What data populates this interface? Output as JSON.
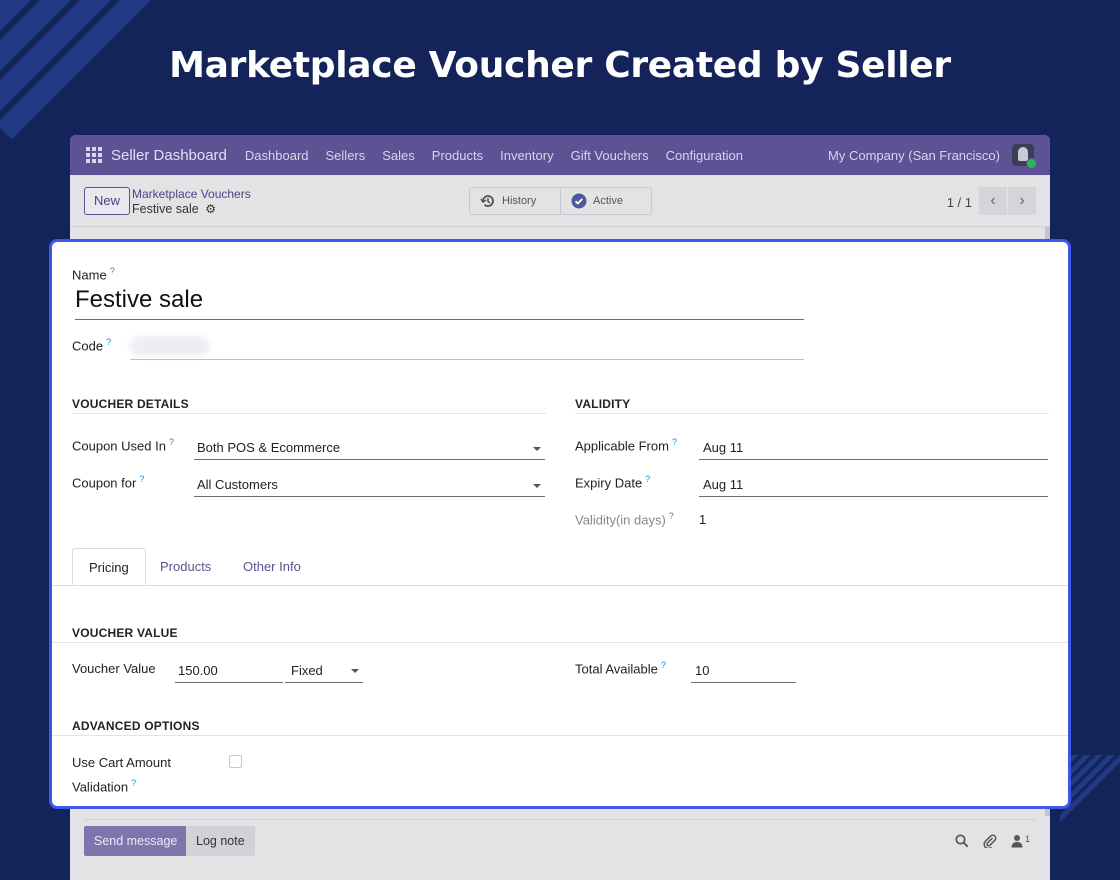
{
  "hero": {
    "title": "Marketplace Voucher Created by Seller"
  },
  "navbar": {
    "brand": "Seller Dashboard",
    "items": [
      "Dashboard",
      "Sellers",
      "Sales",
      "Products",
      "Inventory",
      "Gift Vouchers",
      "Configuration"
    ],
    "company": "My Company (San Francisco)"
  },
  "controlbar": {
    "new_label": "New",
    "breadcrumb_parent": "Marketplace Vouchers",
    "breadcrumb_current": "Festive sale",
    "history_label": "History",
    "active_label": "Active",
    "pager": "1 / 1"
  },
  "form": {
    "name_label": "Name",
    "name_value": "Festive sale",
    "code_label": "Code",
    "help_mark": "?",
    "voucher_details": {
      "title": "VOUCHER DETAILS",
      "coupon_used_in_label": "Coupon Used In",
      "coupon_used_in_value": "Both POS & Ecommerce",
      "coupon_for_label": "Coupon for",
      "coupon_for_value": "All Customers"
    },
    "validity": {
      "title": "VALIDITY",
      "applicable_from_label": "Applicable From",
      "applicable_from_value": "Aug 11",
      "expiry_date_label": "Expiry Date",
      "expiry_date_value": "Aug 11",
      "validity_days_label": "Validity(in days)",
      "validity_days_value": "1"
    },
    "tabs": [
      "Pricing",
      "Products",
      "Other Info"
    ],
    "active_tab": "Pricing",
    "voucher_value_section": {
      "title": "VOUCHER VALUE",
      "voucher_value_label": "Voucher Value",
      "voucher_value": "150.00",
      "voucher_type": "Fixed",
      "total_available_label": "Total Available",
      "total_available_value": "10"
    },
    "advanced": {
      "title": "ADVANCED OPTIONS",
      "cart_validation_label_1": "Use Cart Amount",
      "cart_validation_label_2": "Validation",
      "cart_validation_checked": false
    }
  },
  "chatter": {
    "send_message": "Send message",
    "log_note": "Log note",
    "followers_count": "1"
  },
  "colors": {
    "background": "#14245a",
    "navbar": "#5c5294",
    "highlight_border": "#3b56e8"
  }
}
